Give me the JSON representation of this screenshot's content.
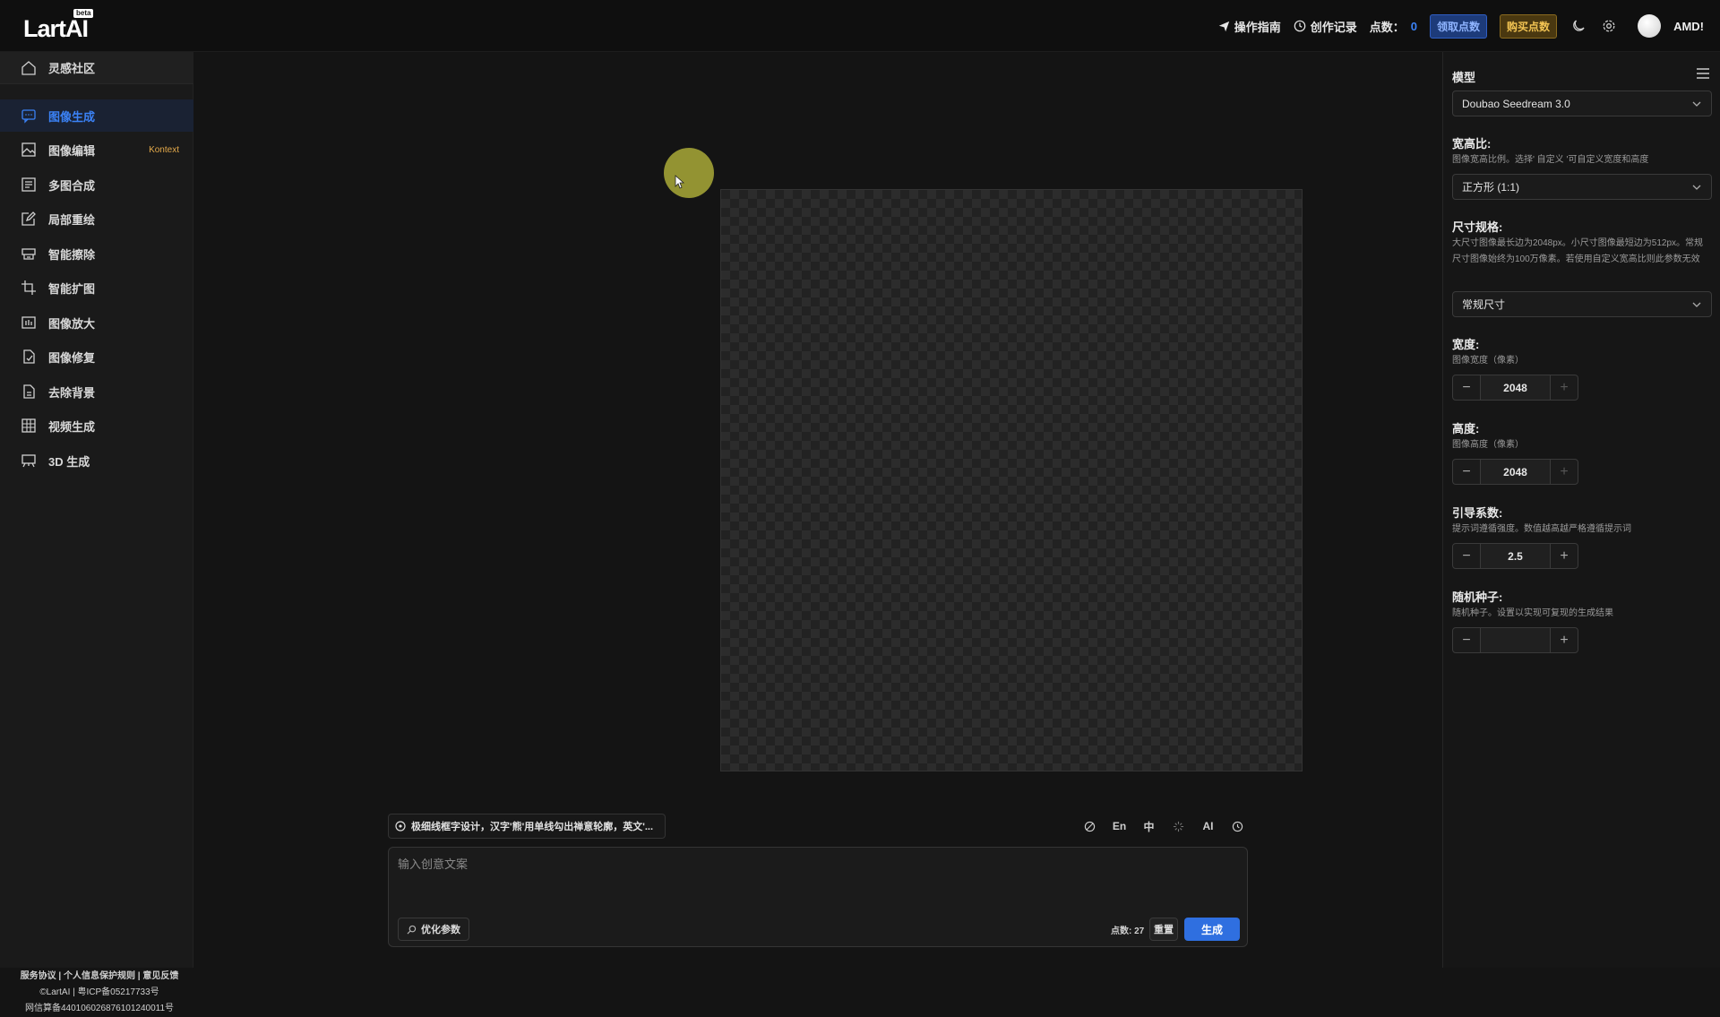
{
  "app": {
    "logo": "LartAI",
    "logo_badge": "beta"
  },
  "topbar": {
    "guide": "操作指南",
    "history": "创作记录",
    "points_label": "点数：",
    "points_value": "0",
    "claim_points": "领取点数",
    "buy_points": "购买点数",
    "username": "AMD!"
  },
  "sidebar": {
    "items": [
      {
        "label": "灵感社区",
        "icon": "home-icon"
      },
      {
        "label": "图像生成",
        "icon": "chat-icon"
      },
      {
        "label": "图像编辑",
        "icon": "image-icon",
        "badge": "Kontext"
      },
      {
        "label": "多图合成",
        "icon": "layers-icon"
      },
      {
        "label": "局部重绘",
        "icon": "edit-icon"
      },
      {
        "label": "智能擦除",
        "icon": "eraser-icon"
      },
      {
        "label": "智能扩图",
        "icon": "crop-icon"
      },
      {
        "label": "图像放大",
        "icon": "upscale-icon"
      },
      {
        "label": "图像修复",
        "icon": "repair-icon"
      },
      {
        "label": "去除背景",
        "icon": "file-icon"
      },
      {
        "label": "视频生成",
        "icon": "grid-icon"
      },
      {
        "label": "3D 生成",
        "icon": "cube-icon"
      }
    ],
    "active_index": 1,
    "footer": {
      "line1": "服务协议 | 个人信息保护规则 | 意见反馈",
      "line2": "©LartAI | 粤ICP备05217733号",
      "line3": "网信算备440106026876101240011号"
    }
  },
  "prompt": {
    "suggestion": "极细线框字设计，汉字'熊'用单线勾出禅意轮廓，英文'...",
    "tools": [
      "En",
      "中",
      "AI"
    ],
    "placeholder": "输入创意文案",
    "optimize": "优化参数",
    "cost": "点数: 27",
    "reset": "重置",
    "generate": "生成"
  },
  "panel": {
    "model_title": "模型",
    "model_value": "Doubao Seedream 3.0",
    "ratio_title": "宽高比:",
    "ratio_desc": "图像宽高比例。选择' 自定义 '可自定义宽度和高度",
    "ratio_value": "正方形 (1:1)",
    "size_title": "尺寸规格:",
    "size_desc": "大尺寸图像最长边为2048px。小尺寸图像最短边为512px。常规尺寸图像始终为100万像素。若使用自定义宽高比则此参数无效",
    "size_value": "常规尺寸",
    "width_title": "宽度:",
    "width_desc": "图像宽度（像素）",
    "width_value": "2048",
    "height_title": "高度:",
    "height_desc": "图像高度（像素）",
    "height_value": "2048",
    "guidance_title": "引导系数:",
    "guidance_desc": "提示词遵循强度。数值越高越严格遵循提示词",
    "guidance_value": "2.5",
    "seed_title": "随机种子:",
    "seed_desc": "随机种子。设置以实现可复现的生成结果",
    "seed_value": ""
  },
  "colors": {
    "accent": "#3b82f6",
    "claim": "#2f5ec4",
    "buy": "#f2c453",
    "generate": "#2f6fe0"
  }
}
